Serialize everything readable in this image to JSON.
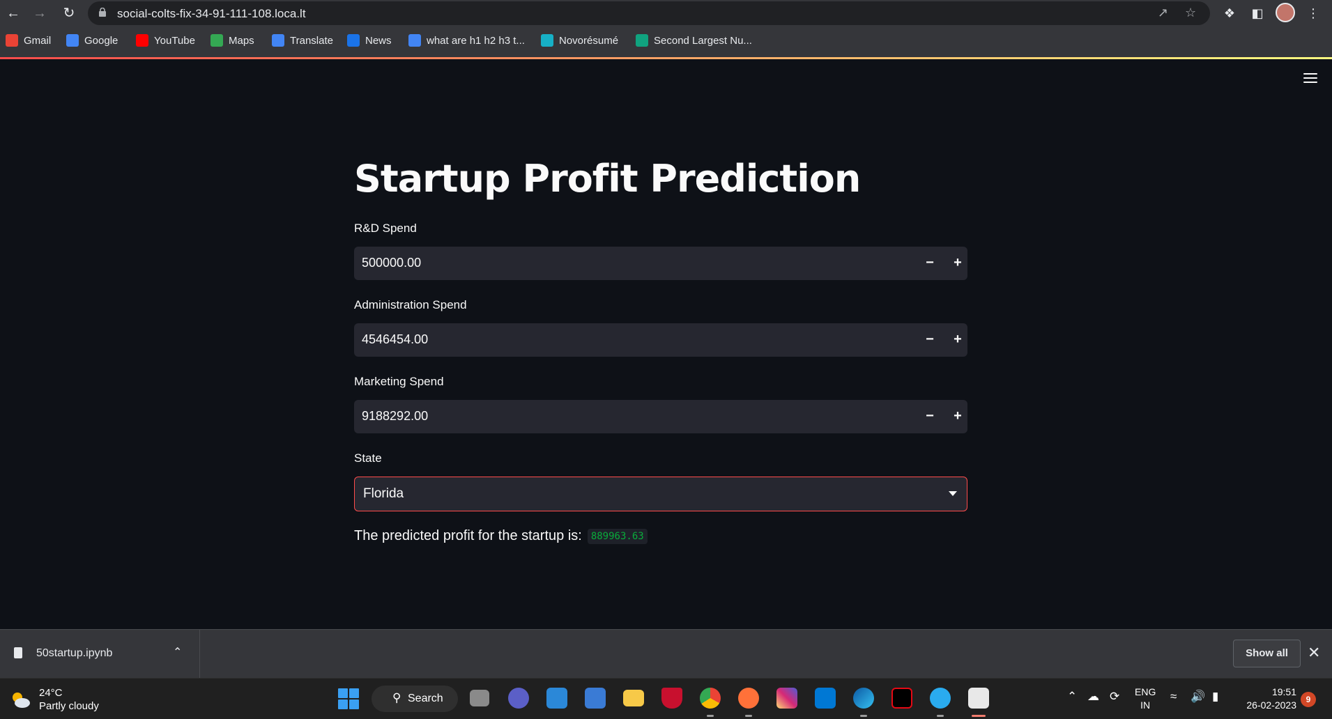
{
  "browser": {
    "url": "social-colts-fix-34-91-111-108.loca.lt",
    "bookmarks": [
      {
        "label": "Gmail",
        "color": "#ea4335"
      },
      {
        "label": "Google",
        "color": "#4285f4"
      },
      {
        "label": "YouTube",
        "color": "#ff0000"
      },
      {
        "label": "Maps",
        "color": "#34a853"
      },
      {
        "label": "Translate",
        "color": "#4285f4"
      },
      {
        "label": "News",
        "color": "#1a73e8"
      },
      {
        "label": "what are h1 h2 h3 t...",
        "color": "#4285f4"
      },
      {
        "label": "Novorésumé",
        "color": "#17b0c6"
      },
      {
        "label": "Second Largest Nu...",
        "color": "#10a37f"
      }
    ]
  },
  "app": {
    "title": "Startup Profit Prediction",
    "fields": {
      "rd_spend": {
        "label": "R&D Spend",
        "value": "500000.00"
      },
      "admin_spend": {
        "label": "Administration Spend",
        "value": "4546454.00"
      },
      "marketing_spend": {
        "label": "Marketing Spend",
        "value": "9188292.00"
      }
    },
    "state": {
      "label": "State",
      "value": "Florida"
    },
    "result": {
      "text": "The predicted profit for the startup is:",
      "value": "889963.63"
    },
    "accent_color": "#ff4b4b",
    "result_color": "#09ab3b"
  },
  "downloads": {
    "file": "50startup.ipynb",
    "show_all": "Show all"
  },
  "taskbar": {
    "weather": {
      "temp": "24°C",
      "desc": "Partly cloudy"
    },
    "search_label": "Search",
    "lang": {
      "line1": "ENG",
      "line2": "IN"
    },
    "clock": {
      "time": "19:51",
      "date": "26-02-2023"
    },
    "notifications": "9"
  }
}
